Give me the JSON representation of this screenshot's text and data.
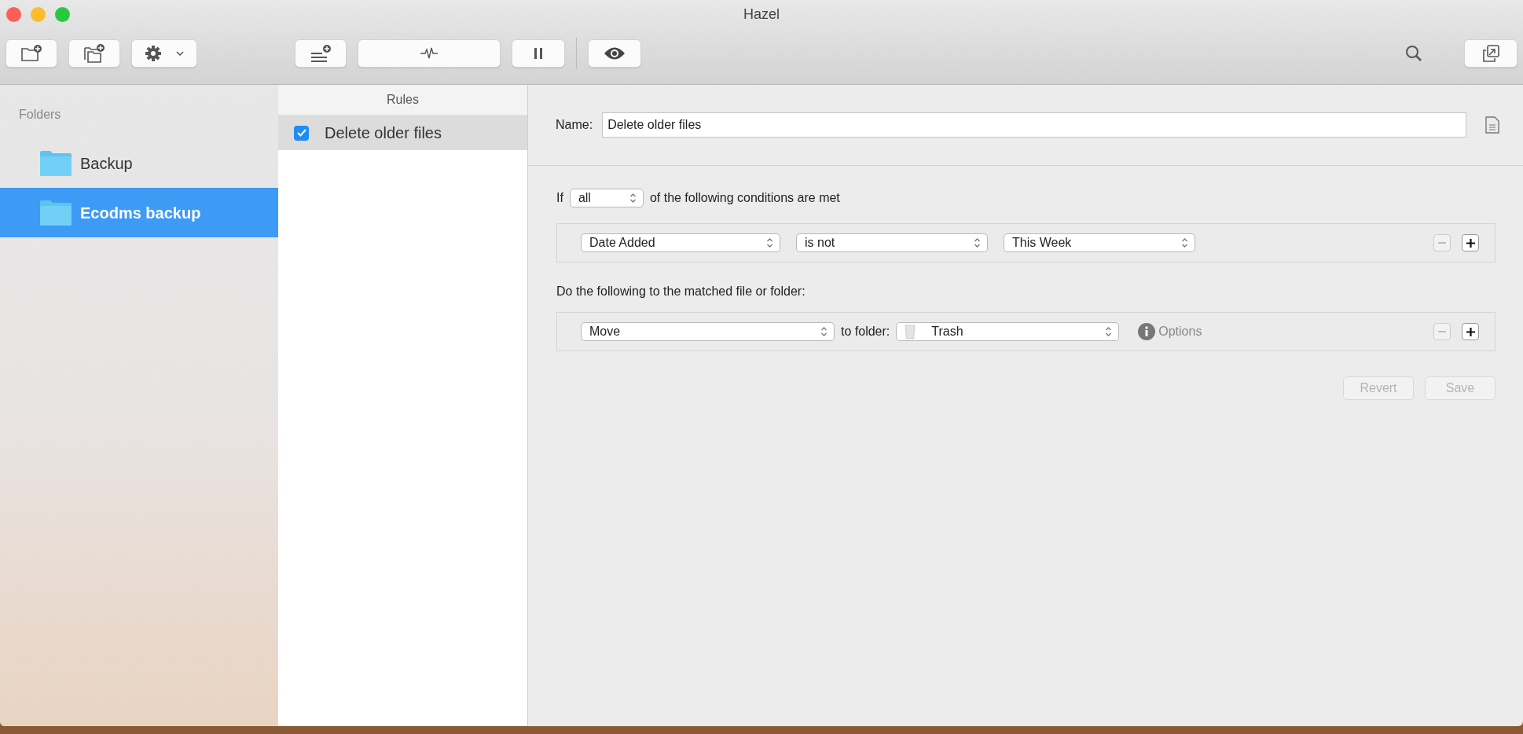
{
  "window": {
    "title": "Hazel"
  },
  "sidebar": {
    "header": "Folders",
    "items": [
      {
        "label": "Backup",
        "selected": false
      },
      {
        "label": "Ecodms backup",
        "selected": true
      }
    ]
  },
  "rules": {
    "header": "Rules",
    "items": [
      {
        "label": "Delete older files",
        "checked": true,
        "selected": true
      }
    ]
  },
  "editor": {
    "name_label": "Name:",
    "name_value": "Delete older files",
    "conditions": {
      "prefix": "If",
      "match": "all",
      "suffix": "of the following conditions are met",
      "rows": [
        {
          "fields": [
            "Date Added",
            "is not",
            "This Week"
          ],
          "can_remove": false
        }
      ]
    },
    "actions": {
      "heading": "Do the following to the matched file or folder:",
      "rows": [
        {
          "action": "Move",
          "connector": "to folder:",
          "target": "Trash",
          "options": "Options",
          "can_remove": false
        }
      ]
    },
    "buttons": [
      {
        "label": "Revert",
        "disabled": true
      },
      {
        "label": "Save",
        "disabled": true
      }
    ]
  }
}
